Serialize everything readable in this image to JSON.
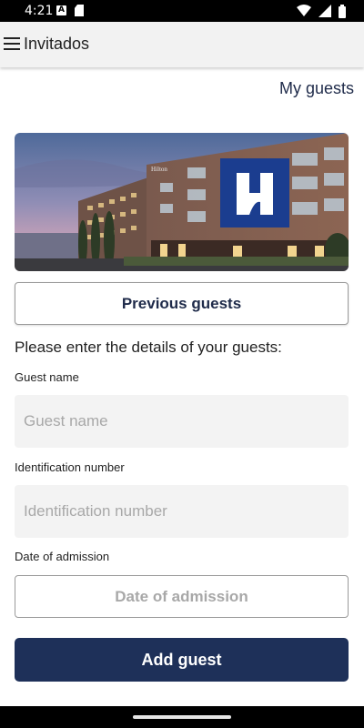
{
  "status_bar": {
    "time": "4:21",
    "notification_icons": [
      "a-badge-icon",
      "sd-card-icon"
    ],
    "system_icons": [
      "wifi-icon",
      "signal-icon",
      "battery-icon"
    ]
  },
  "app_bar": {
    "title": "Invitados",
    "menu_icon": "hamburger-menu-icon"
  },
  "links": {
    "my_guests": "My guests"
  },
  "banner": {
    "logo_letter": "H",
    "sign_text": "Hilton"
  },
  "buttons": {
    "previous_guests": "Previous guests",
    "add_guest": "Add guest"
  },
  "form": {
    "instructions": "Please enter the details of your guests:",
    "guest_name": {
      "label": "Guest name",
      "placeholder": "Guest name",
      "value": ""
    },
    "identification": {
      "label": "Identification number",
      "placeholder": "Identification number",
      "value": ""
    },
    "date_of_admission": {
      "label": "Date of admission",
      "placeholder": "Date of admission"
    }
  },
  "colors": {
    "primary": "#1e3059",
    "link": "#1f2b4a",
    "app_bar_bg": "#f2f2f2",
    "field_bg": "#f3f3f3",
    "logo_blue": "#1b3d8f"
  }
}
